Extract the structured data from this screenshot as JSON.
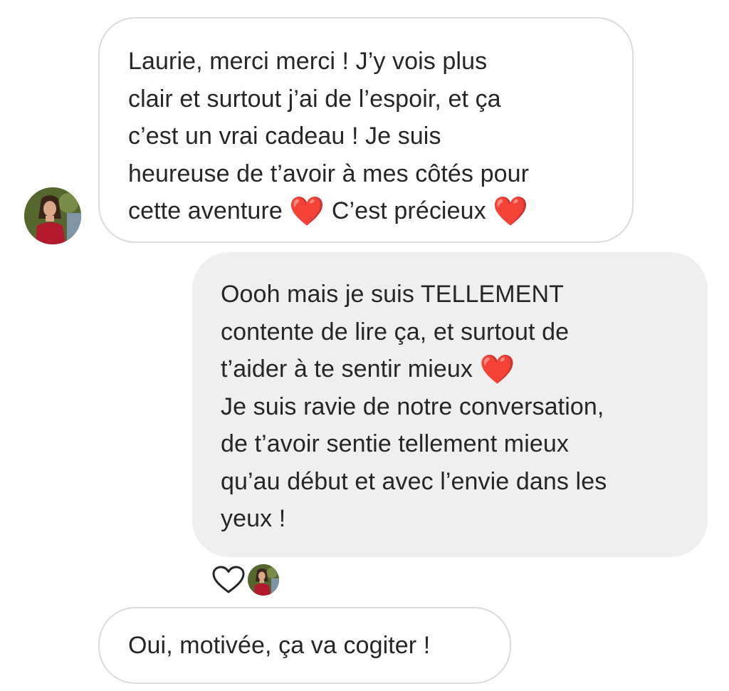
{
  "messages": [
    {
      "direction": "received",
      "text": "Laurie, merci merci ! J’y vois plus\nclair et surtout j’ai de l’espoir, et ça\nc’est un vrai cadeau ! Je suis\nheureuse de t’avoir à mes côtés pour\ncette aventure ",
      "emoji_1": "❤️",
      "text_2": " C’est précieux ",
      "emoji_2": "❤️"
    },
    {
      "direction": "sent",
      "text": "Oooh mais je suis TELLEMENT\ncontente de lire ça, et surtout de\nt’aider à te sentir mieux ",
      "emoji": "❤️",
      "text_2": "\nJe suis ravie de notre conversation,\nde t’avoir sentie tellement mieux\nqu’au début et avec l’envie dans les\nyeux !",
      "reaction": "heart-outline-icon"
    },
    {
      "direction": "received",
      "text": "Oui, motivée, ça va cogiter !"
    }
  ],
  "colors": {
    "received_bubble_bg": "#ffffff",
    "received_bubble_border": "#dbdbdb",
    "sent_bubble_bg": "#efefef",
    "text": "#262626",
    "heart": "#e8112d"
  },
  "icons": {
    "reaction": "heart-outline-icon",
    "avatar": "user-avatar-photo"
  }
}
